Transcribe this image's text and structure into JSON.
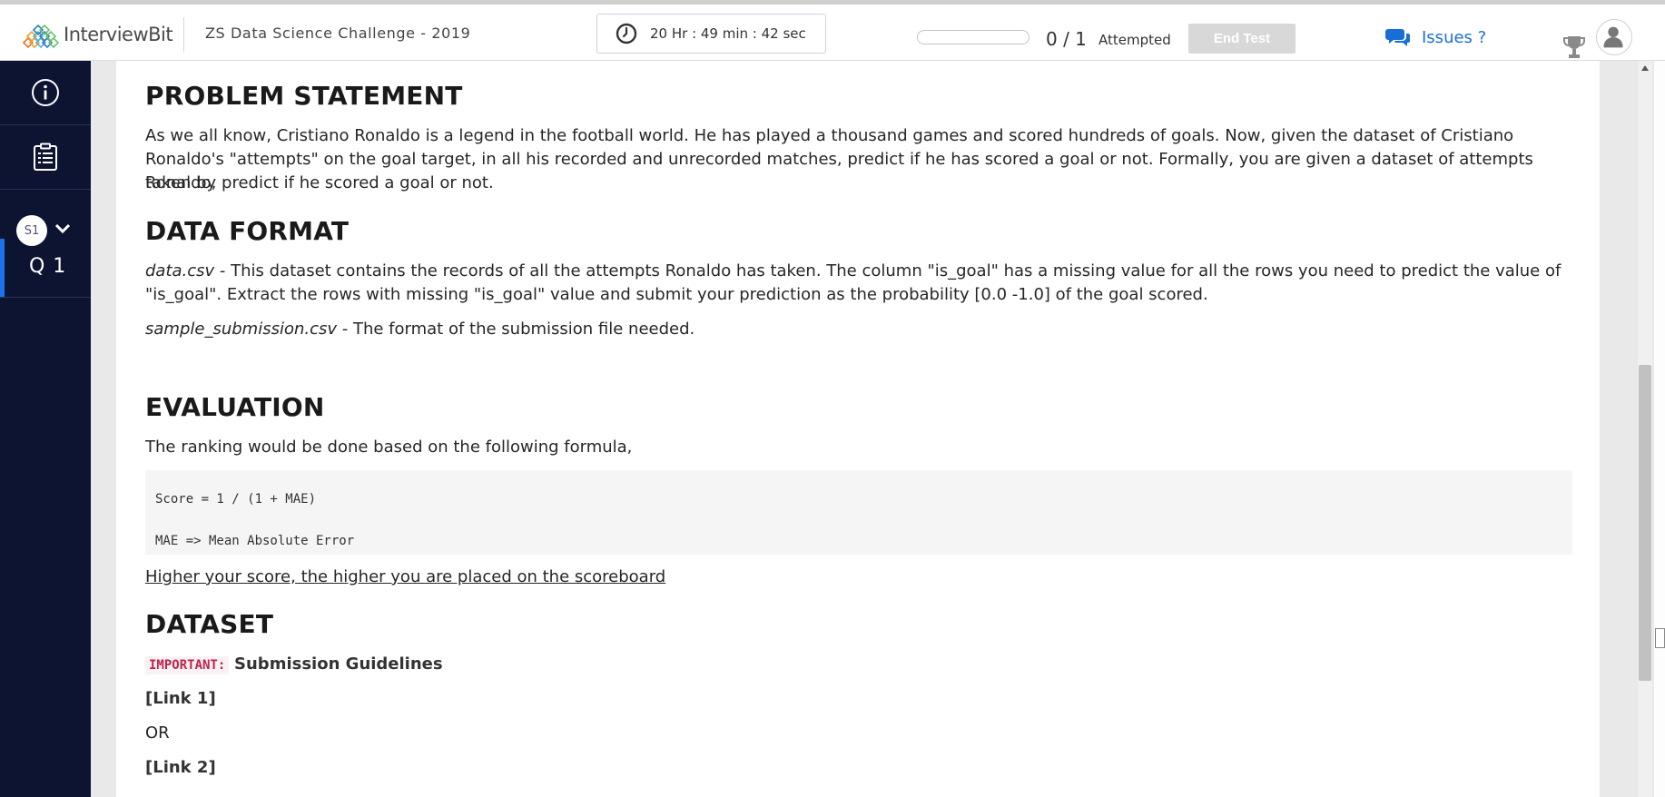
{
  "header": {
    "logo_text": "InterviewBit",
    "challenge_title": "ZS Data Science Challenge - 2019",
    "timer": "20 Hr : 49 min : 42 sec",
    "progress_fraction": 0,
    "attempted_count": "0 / 1",
    "attempted_label": "Attempted",
    "end_test_label": "End Test",
    "issues_label": "Issues ?"
  },
  "sidebar": {
    "section_badge": "S1",
    "question_label": "Q 1"
  },
  "content": {
    "problem_heading": "PROBLEM STATEMENT",
    "problem_text_1": "As we all know, Cristiano Ronaldo is a legend in the football world. He has played a thousand games and scored hundreds of goals. Now, given the dataset of Cristiano",
    "problem_text_2": "Ronaldo's \"attempts\" on the goal target, in all his recorded and unrecorded matches, predict if he has scored a goal or not. Formally, you are given a dataset of attempts taken by",
    "problem_text_3": "Ronaldo, predict if he scored a goal or not.",
    "data_format_heading": "DATA FORMAT",
    "data_file_name": "data.csv",
    "data_file_desc_1": " - This dataset contains the records of all the attempts Ronaldo has taken. The column \"is_goal\" has a missing value for all the rows you need to predict the value of",
    "data_file_desc_2": "\"is_goal\". Extract the rows with missing \"is_goal\" value and submit your prediction as the probability [0.0 -1.0] of the goal scored.",
    "sample_file_name": "sample_submission.csv",
    "sample_file_desc": " - The format of the submission file needed.",
    "evaluation_heading": "EVALUATION",
    "evaluation_text": "The ranking would be done based on the following formula,",
    "code_line_1": "Score = 1 / (1 + MAE)",
    "code_line_2": "MAE => Mean Absolute Error",
    "score_note": "Higher your score, the higher you are placed on the scoreboard",
    "dataset_heading": "DATASET",
    "important_tag": "IMPORTANT:",
    "guidelines_text": "Submission Guidelines",
    "link_1": "[Link 1]",
    "or_text": "OR",
    "link_2": "[Link 2]"
  },
  "colors": {
    "sidebar_bg": "#0d1432",
    "accent_blue": "#1a73e8",
    "issues_blue": "#1a6fd6",
    "important_red": "#c0234a",
    "end_test_disabled": "#d8d8d8"
  },
  "icons": [
    "logo-mark-icon",
    "clock-icon",
    "chat-icon",
    "trophy-icon",
    "user-avatar-icon",
    "info-icon",
    "clipboard-list-icon",
    "chevron-down-icon"
  ]
}
